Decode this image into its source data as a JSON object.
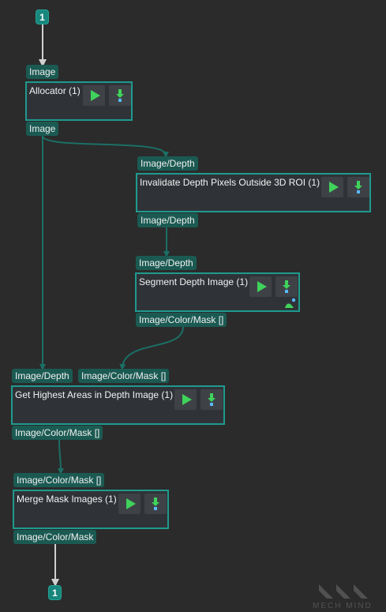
{
  "graph": {
    "input_badge": "1",
    "output_badge": "1",
    "nodes": [
      {
        "title": "Allocator (1)",
        "input_port": "Image",
        "output_port": "Image"
      },
      {
        "title": "Invalidate Depth Pixels Outside 3D ROI (1)",
        "input_port": "Image/Depth",
        "output_port": "Image/Depth"
      },
      {
        "title": "Segment Depth Image (1)",
        "input_port": "Image/Depth",
        "output_port": "Image/Color/Mask []"
      },
      {
        "title": "Get Highest Areas in Depth Image (1)",
        "input_ports": [
          "Image/Depth",
          "Image/Color/Mask []"
        ],
        "output_port": "Image/Color/Mask []"
      },
      {
        "title": "Merge Mask Images (1)",
        "input_port": "Image/Color/Mask []",
        "output_port": "Image/Color/Mask"
      }
    ]
  },
  "watermark": {
    "text": "MECH MIND"
  },
  "colors": {
    "background": "#2b2b2b",
    "node_border": "#1e9a8e",
    "port_fill": "#1b5a52",
    "wire": "#1b6f66",
    "io_wire": "#d0d0d0",
    "play_green": "#3fd35b"
  },
  "icons": [
    "run-icon",
    "download-icon",
    "segment-corner-icon"
  ]
}
